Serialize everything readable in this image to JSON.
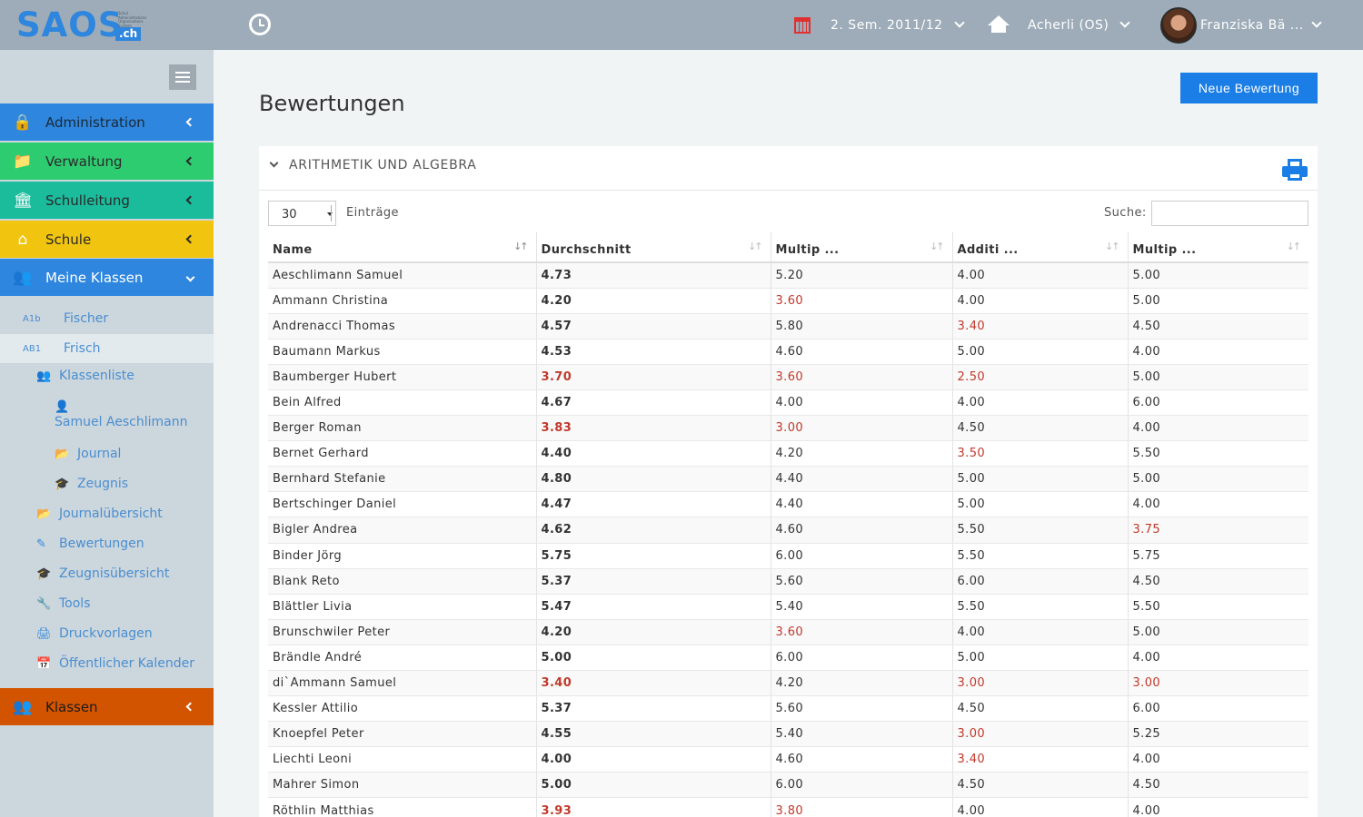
{
  "topbar": {
    "logo_text": "SAOS",
    "logo_ch": ".ch",
    "logo_sub": "Schul Administrations Organisations System",
    "semester": "2. Sem. 2011/12",
    "school": "Acherli (OS)",
    "user": "Franziska Bä ..."
  },
  "sidebar": {
    "sections": [
      {
        "label": "Administration",
        "color": "#2e86de",
        "icon": "lock-icon"
      },
      {
        "label": "Verwaltung",
        "color": "#2ecc71",
        "icon": "folder-icon"
      },
      {
        "label": "Schulleitung",
        "color": "#1abc9c",
        "icon": "bank-icon"
      },
      {
        "label": "Schule",
        "color": "#f1c40f",
        "icon": "home-icon"
      },
      {
        "label": "Meine Klassen",
        "color": "#2e86de",
        "icon": "users-icon"
      }
    ],
    "classes": [
      {
        "code": "A1b",
        "name": "Fischer"
      },
      {
        "code": "AB1",
        "name": "Frisch"
      }
    ],
    "items": [
      {
        "label": "Klassenliste",
        "icon": "users-icon"
      },
      {
        "label": "Samuel Aeschlimann",
        "icon": "person-icon"
      },
      {
        "label": "Journal",
        "icon": "folder-open-icon"
      },
      {
        "label": "Zeugnis",
        "icon": "graduation-cap-icon"
      },
      {
        "label": "Journalübersicht",
        "icon": "folder-open-icon"
      },
      {
        "label": "Bewertungen",
        "icon": "pencil-icon"
      },
      {
        "label": "Zeugnisübersicht",
        "icon": "graduation-cap-icon"
      },
      {
        "label": "Tools",
        "icon": "wrench-icon"
      },
      {
        "label": "Druckvorlagen",
        "icon": "print-icon"
      },
      {
        "label": "Öffentlicher Kalender",
        "icon": "calendar-icon"
      }
    ],
    "bottom_section": {
      "label": "Klassen",
      "color": "#d35400",
      "icon": "users-icon"
    }
  },
  "main": {
    "title": "Bewertungen",
    "new_button": "Neue Bewertung",
    "panel_title": "ARITHMETIK UND ALGEBRA",
    "page_length": "30",
    "page_length_label": "Einträge",
    "search_label": "Suche:",
    "search_value": "",
    "columns": [
      "Name",
      "Durchschnitt",
      "Multip ...",
      "Additi ...",
      "Multip ..."
    ],
    "rows": [
      [
        "Aeschlimann Samuel",
        "4.73",
        "5.20",
        "4.00",
        "5.00"
      ],
      [
        "Ammann Christina",
        "4.20",
        "3.60",
        "4.00",
        "5.00"
      ],
      [
        "Andrenacci Thomas",
        "4.57",
        "5.80",
        "3.40",
        "4.50"
      ],
      [
        "Baumann Markus",
        "4.53",
        "4.60",
        "5.00",
        "4.00"
      ],
      [
        "Baumberger Hubert",
        "3.70",
        "3.60",
        "2.50",
        "5.00"
      ],
      [
        "Bein Alfred",
        "4.67",
        "4.00",
        "4.00",
        "6.00"
      ],
      [
        "Berger Roman",
        "3.83",
        "3.00",
        "4.50",
        "4.00"
      ],
      [
        "Bernet Gerhard",
        "4.40",
        "4.20",
        "3.50",
        "5.50"
      ],
      [
        "Bernhard Stefanie",
        "4.80",
        "4.40",
        "5.00",
        "5.00"
      ],
      [
        "Bertschinger Daniel",
        "4.47",
        "4.40",
        "5.00",
        "4.00"
      ],
      [
        "Bigler Andrea",
        "4.62",
        "4.60",
        "5.50",
        "3.75"
      ],
      [
        "Binder Jörg",
        "5.75",
        "6.00",
        "5.50",
        "5.75"
      ],
      [
        "Blank Reto",
        "5.37",
        "5.60",
        "6.00",
        "4.50"
      ],
      [
        "Blättler Livia",
        "5.47",
        "5.40",
        "5.50",
        "5.50"
      ],
      [
        "Brunschwiler Peter",
        "4.20",
        "3.60",
        "4.00",
        "5.00"
      ],
      [
        "Brändle André",
        "5.00",
        "6.00",
        "5.00",
        "4.00"
      ],
      [
        "di`Ammann Samuel",
        "3.40",
        "4.20",
        "3.00",
        "3.00"
      ],
      [
        "Kessler Attilio",
        "5.37",
        "5.60",
        "4.50",
        "6.00"
      ],
      [
        "Knoepfel Peter",
        "4.55",
        "5.40",
        "3.00",
        "5.25"
      ],
      [
        "Liechti Leoni",
        "4.00",
        "4.60",
        "3.40",
        "4.00"
      ],
      [
        "Mahrer Simon",
        "5.00",
        "6.00",
        "4.50",
        "4.50"
      ],
      [
        "Röthlin Matthias",
        "3.93",
        "3.80",
        "4.00",
        "4.00"
      ]
    ],
    "low_color": "#c0392b"
  }
}
